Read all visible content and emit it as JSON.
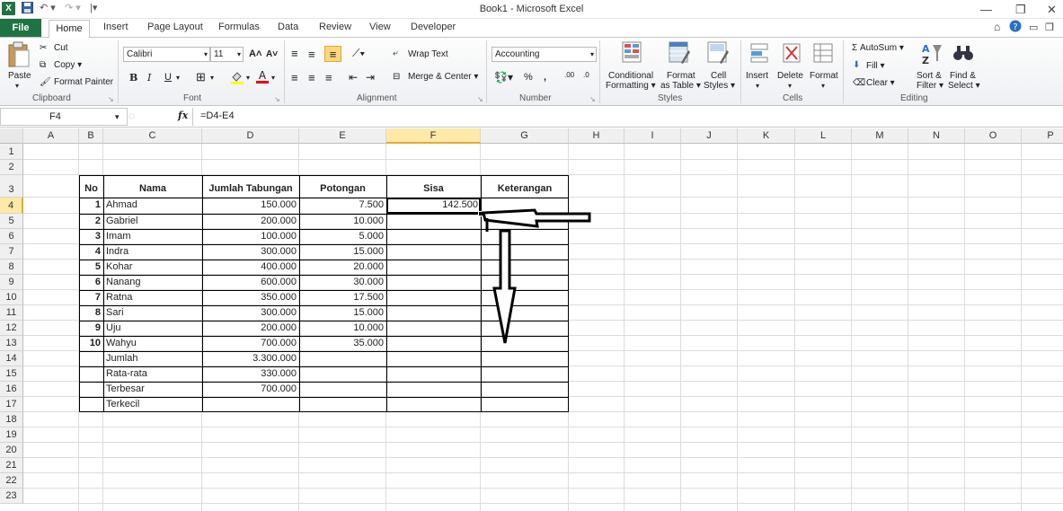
{
  "window": {
    "title": "Book1  -  Microsoft Excel",
    "app_icon": "X",
    "qat_undo": "↶ ▾",
    "qat_redo": "↷ ▾",
    "qat_custom": "|▾",
    "minimize": "—",
    "restore": "❐",
    "close": "✕"
  },
  "ribbon_tabs": {
    "file": "File",
    "home": "Home",
    "insert": "Insert",
    "page_layout": "Page Layout",
    "formulas": "Formulas",
    "data": "Data",
    "review": "Review",
    "view": "View",
    "developer": "Developer"
  },
  "clipboard": {
    "label": "Clipboard",
    "paste": "Paste",
    "cut": "Cut",
    "copy": "Copy ▾",
    "format_painter": "Format Painter"
  },
  "font": {
    "label": "Font",
    "name": "Calibri",
    "size": "11",
    "bold": "B",
    "italic": "I",
    "underline": "U",
    "grow": "A˄",
    "shrink": "A˅"
  },
  "alignment": {
    "label": "Alignment",
    "wrap_text": "Wrap Text",
    "merge_center": "Merge & Center ▾"
  },
  "number": {
    "label": "Number",
    "format": "Accounting",
    "percent": "%",
    "comma": ",",
    "inc_dec": ".00",
    "dec_dec": ".0"
  },
  "styles": {
    "label": "Styles",
    "conditional_1": "Conditional",
    "conditional_2": "Formatting ▾",
    "format_table_1": "Format",
    "format_table_2": "as Table ▾",
    "cell_styles_1": "Cell",
    "cell_styles_2": "Styles ▾"
  },
  "cells": {
    "label": "Cells",
    "insert": "Insert",
    "delete": "Delete",
    "format": "Format"
  },
  "editing": {
    "label": "Editing",
    "autosum": "Σ AutoSum ▾",
    "fill": "Fill ▾",
    "clear": "Clear ▾",
    "sort_1": "Sort &",
    "sort_2": "Filter ▾",
    "find_1": "Find &",
    "find_2": "Select ▾"
  },
  "formula_bar": {
    "name_box": "F4",
    "fx": "fx",
    "formula": "=D4-E4"
  },
  "columns": [
    "A",
    "B",
    "C",
    "D",
    "E",
    "F",
    "G",
    "H",
    "I",
    "J",
    "K",
    "L",
    "M",
    "N",
    "O",
    "P"
  ],
  "rows": [
    "1",
    "2",
    "3",
    "4",
    "5",
    "6",
    "7",
    "8",
    "9",
    "10",
    "11",
    "12",
    "13",
    "14",
    "15",
    "16",
    "17",
    "18",
    "19",
    "20",
    "21",
    "22",
    "23"
  ],
  "table": {
    "headers": [
      "No",
      "Nama",
      "Jumlah Tabungan",
      "Potongan",
      "Sisa",
      "Keterangan"
    ],
    "records": [
      {
        "no": "1",
        "nama": "Ahmad",
        "jumlah": "150.000",
        "potongan": "7.500",
        "sisa": "142.500"
      },
      {
        "no": "2",
        "nama": "Gabriel",
        "jumlah": "200.000",
        "potongan": "10.000",
        "sisa": ""
      },
      {
        "no": "3",
        "nama": "Imam",
        "jumlah": "100.000",
        "potongan": "5.000",
        "sisa": ""
      },
      {
        "no": "4",
        "nama": "Indra",
        "jumlah": "300.000",
        "potongan": "15.000",
        "sisa": ""
      },
      {
        "no": "5",
        "nama": "Kohar",
        "jumlah": "400.000",
        "potongan": "20.000",
        "sisa": ""
      },
      {
        "no": "6",
        "nama": "Nanang",
        "jumlah": "600.000",
        "potongan": "30.000",
        "sisa": ""
      },
      {
        "no": "7",
        "nama": "Ratna",
        "jumlah": "350.000",
        "potongan": "17.500",
        "sisa": ""
      },
      {
        "no": "8",
        "nama": "Sari",
        "jumlah": "300.000",
        "potongan": "15.000",
        "sisa": ""
      },
      {
        "no": "9",
        "nama": "Uju",
        "jumlah": "200.000",
        "potongan": "10.000",
        "sisa": ""
      },
      {
        "no": "10",
        "nama": "Wahyu",
        "jumlah": "700.000",
        "potongan": "35.000",
        "sisa": ""
      }
    ],
    "summary": [
      {
        "label": "Jumlah",
        "value": "3.300.000"
      },
      {
        "label": "Rata-rata",
        "value": "330.000"
      },
      {
        "label": "Terbesar",
        "value": "700.000"
      },
      {
        "label": "Terkecil",
        "value": ""
      }
    ]
  },
  "selected_cell": "F4",
  "accent_color": "#1f7244"
}
